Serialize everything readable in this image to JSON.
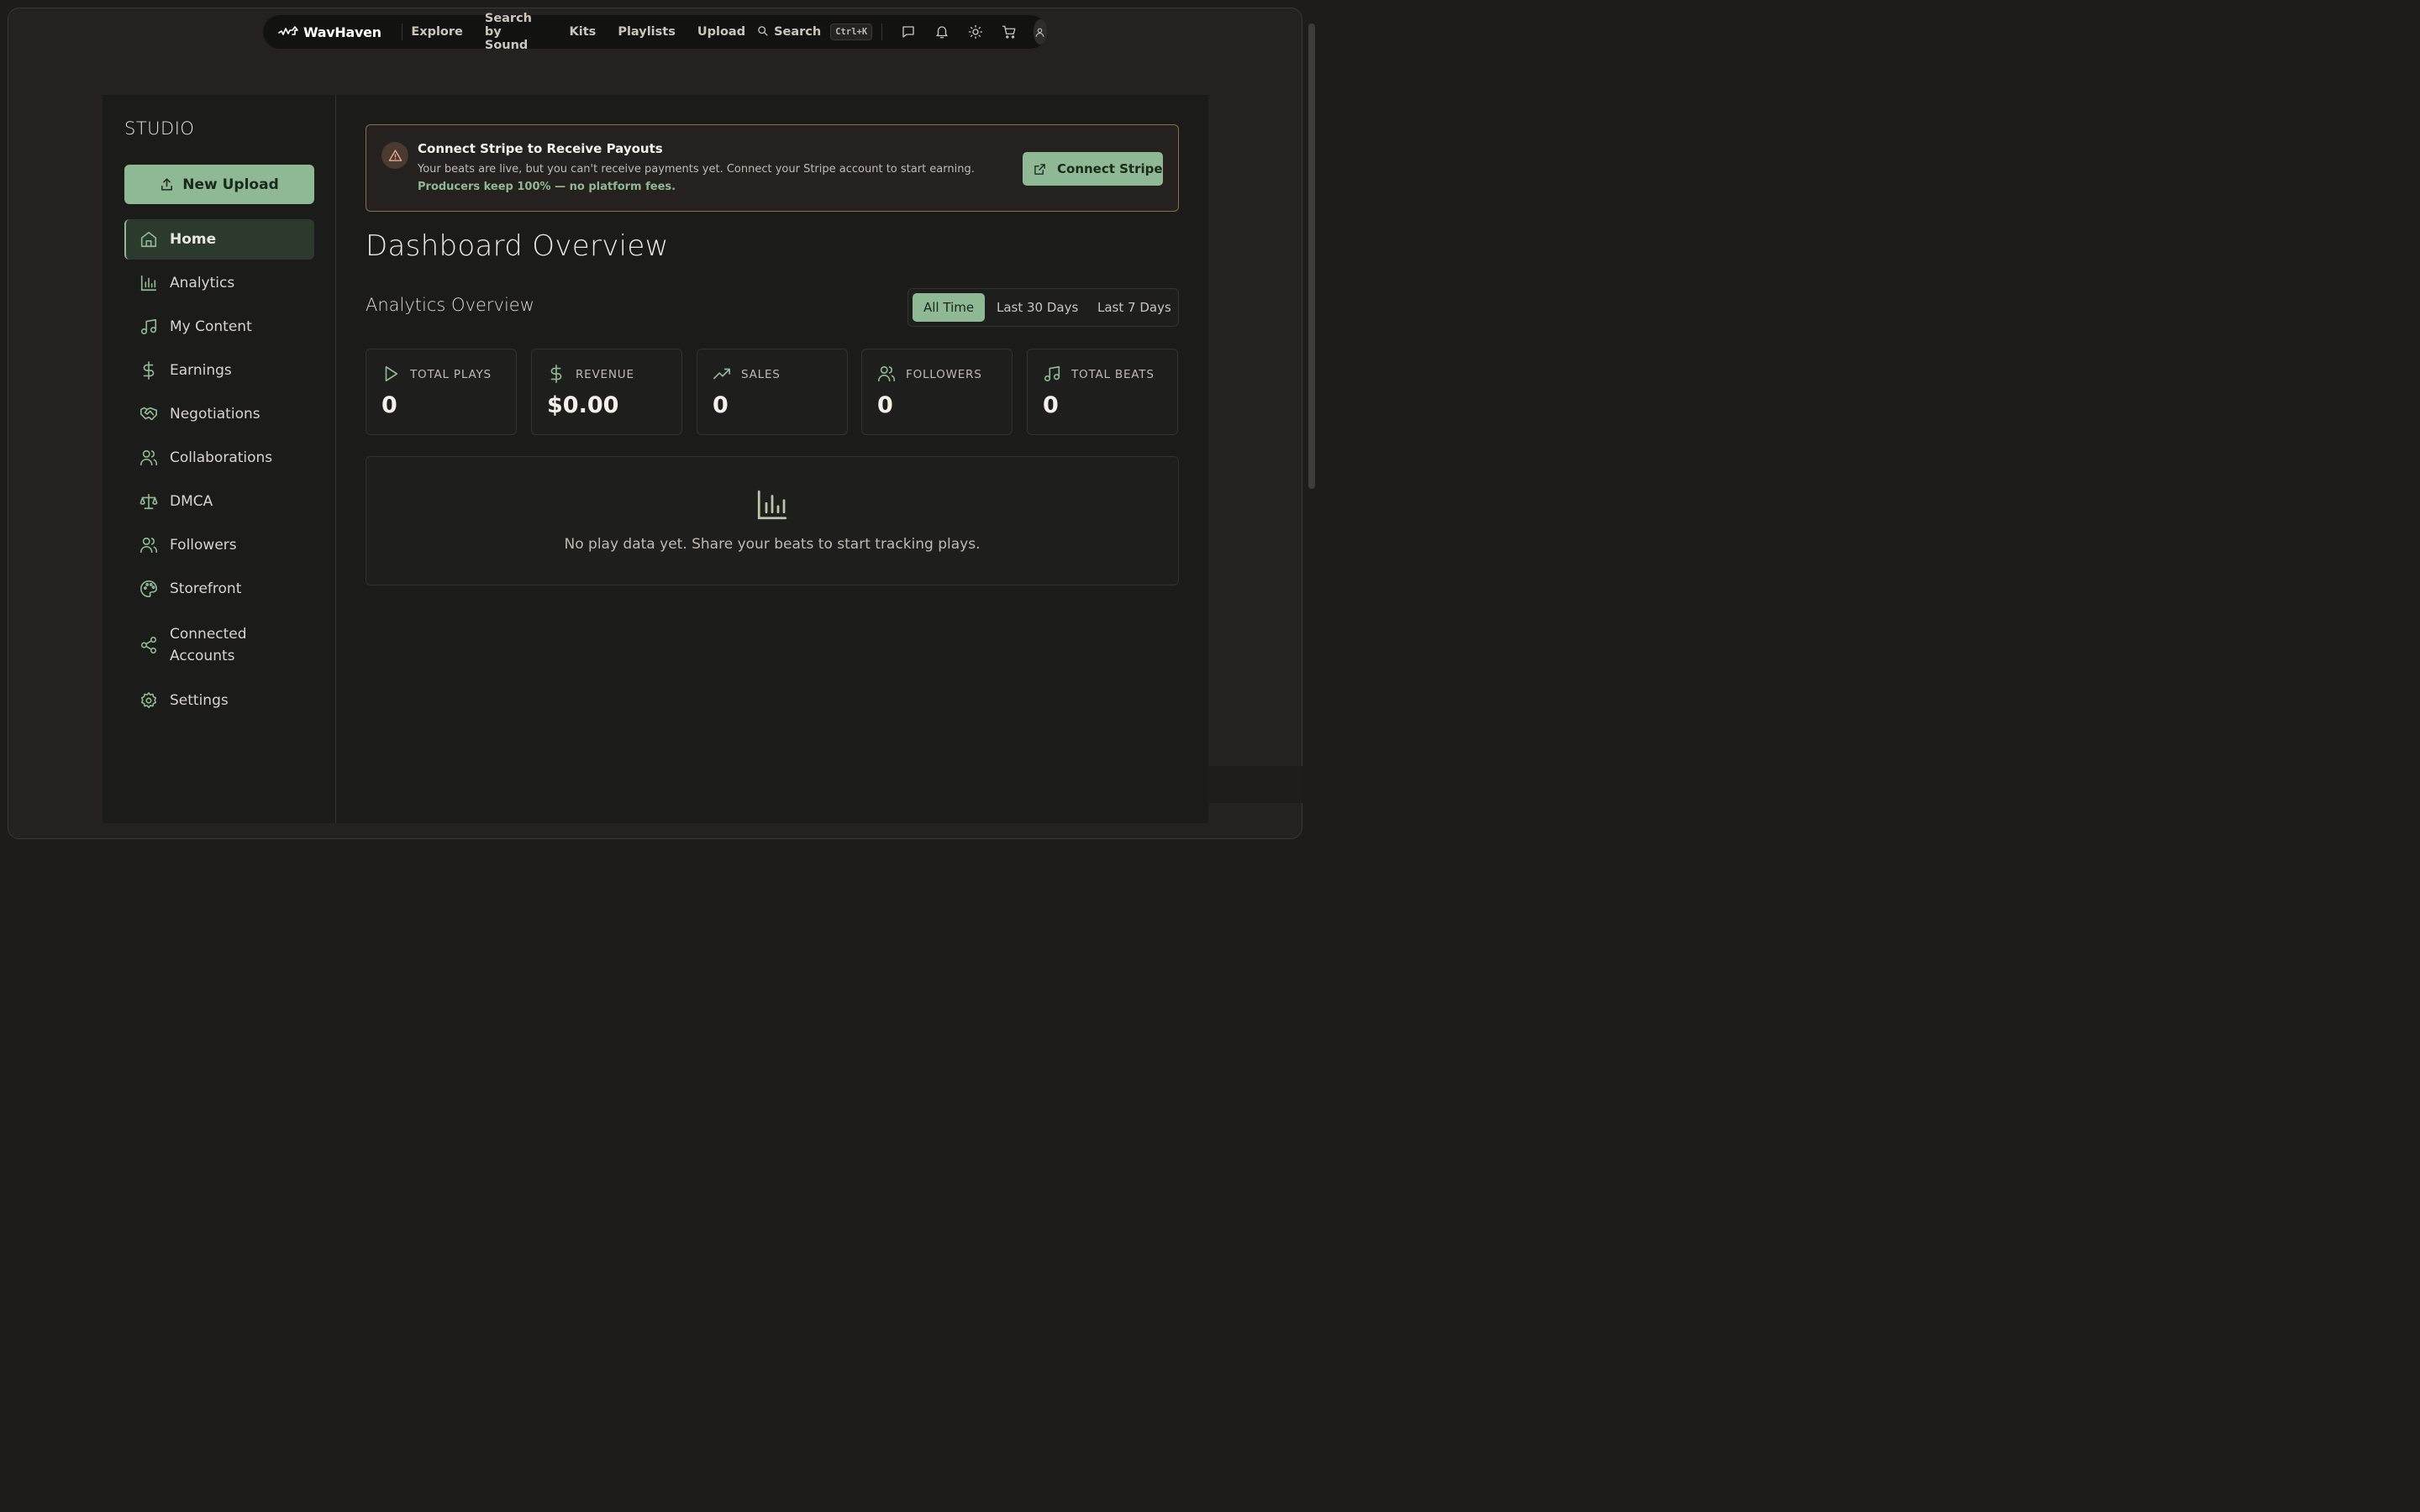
{
  "app": {
    "name": "WavHaven"
  },
  "topnav": {
    "links": [
      "Explore",
      "Search by Sound",
      "Kits",
      "Playlists",
      "Upload"
    ],
    "search_label": "Search",
    "shortcut": "Ctrl+K",
    "icons": [
      "message-icon",
      "bell-icon",
      "sun-icon",
      "cart-icon",
      "user-icon"
    ]
  },
  "sidebar": {
    "section_title": "STUDIO",
    "new_upload_label": "New Upload",
    "items": [
      {
        "label": "Home",
        "icon": "home-icon",
        "active": true
      },
      {
        "label": "Analytics",
        "icon": "bar-chart-icon"
      },
      {
        "label": "My Content",
        "icon": "music-note-icon"
      },
      {
        "label": "Earnings",
        "icon": "dollar-icon"
      },
      {
        "label": "Negotiations",
        "icon": "handshake-icon"
      },
      {
        "label": "Collaborations",
        "icon": "users-icon"
      },
      {
        "label": "DMCA",
        "icon": "scale-icon"
      },
      {
        "label": "Followers",
        "icon": "users-icon"
      },
      {
        "label": "Storefront",
        "icon": "palette-icon"
      },
      {
        "label": "Connected Accounts",
        "icon": "share-icon"
      },
      {
        "label": "Settings",
        "icon": "gear-icon"
      }
    ]
  },
  "banner": {
    "title": "Connect Stripe to Receive Payouts",
    "text": "Your beats are live, but you can't receive payments yet. Connect your Stripe account to start earning.",
    "highlight": "Producers keep 100% — no platform fees.",
    "button_label": "Connect Stripe"
  },
  "main": {
    "title": "Dashboard Overview",
    "analytics_title": "Analytics Overview",
    "ranges": [
      "All Time",
      "Last 30 Days",
      "Last 7 Days"
    ],
    "active_range": "All Time",
    "stats": [
      {
        "label": "TOTAL PLAYS",
        "value": "0",
        "icon": "play-icon"
      },
      {
        "label": "REVENUE",
        "value": "$0.00",
        "icon": "dollar-icon"
      },
      {
        "label": "SALES",
        "value": "0",
        "icon": "trending-up-icon"
      },
      {
        "label": "FOLLOWERS",
        "value": "0",
        "icon": "users-icon"
      },
      {
        "label": "TOTAL BEATS",
        "value": "0",
        "icon": "music-note-icon"
      }
    ],
    "empty_message": "No play data yet. Share your beats to start tracking plays."
  },
  "colors": {
    "accent": "#8fb894",
    "background": "#1b1b1a",
    "warning_border": "#8b6a4e"
  }
}
